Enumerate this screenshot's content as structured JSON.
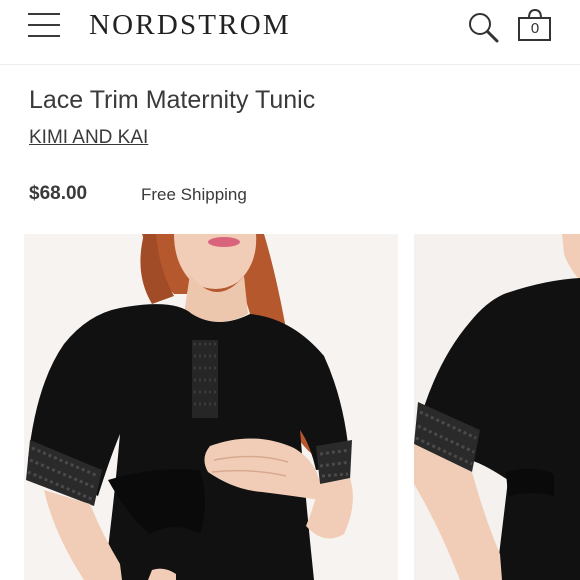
{
  "header": {
    "brand_logo": "NORDSTROM",
    "bag_count": "0",
    "icons": {
      "menu": "hamburger-menu-icon",
      "search": "search-icon",
      "bag": "shopping-bag-icon"
    }
  },
  "product": {
    "title": "Lace Trim Maternity Tunic",
    "brand": "KIMI AND KAI",
    "price": "$68.00",
    "shipping": "Free Shipping"
  },
  "gallery": {
    "images": [
      "front-view-model-photo",
      "side-view-model-photo"
    ]
  },
  "colors": {
    "text": "#3a3a3a",
    "garment": "#111111",
    "hair": "#b5582e",
    "skin": "#f1cdb8"
  }
}
